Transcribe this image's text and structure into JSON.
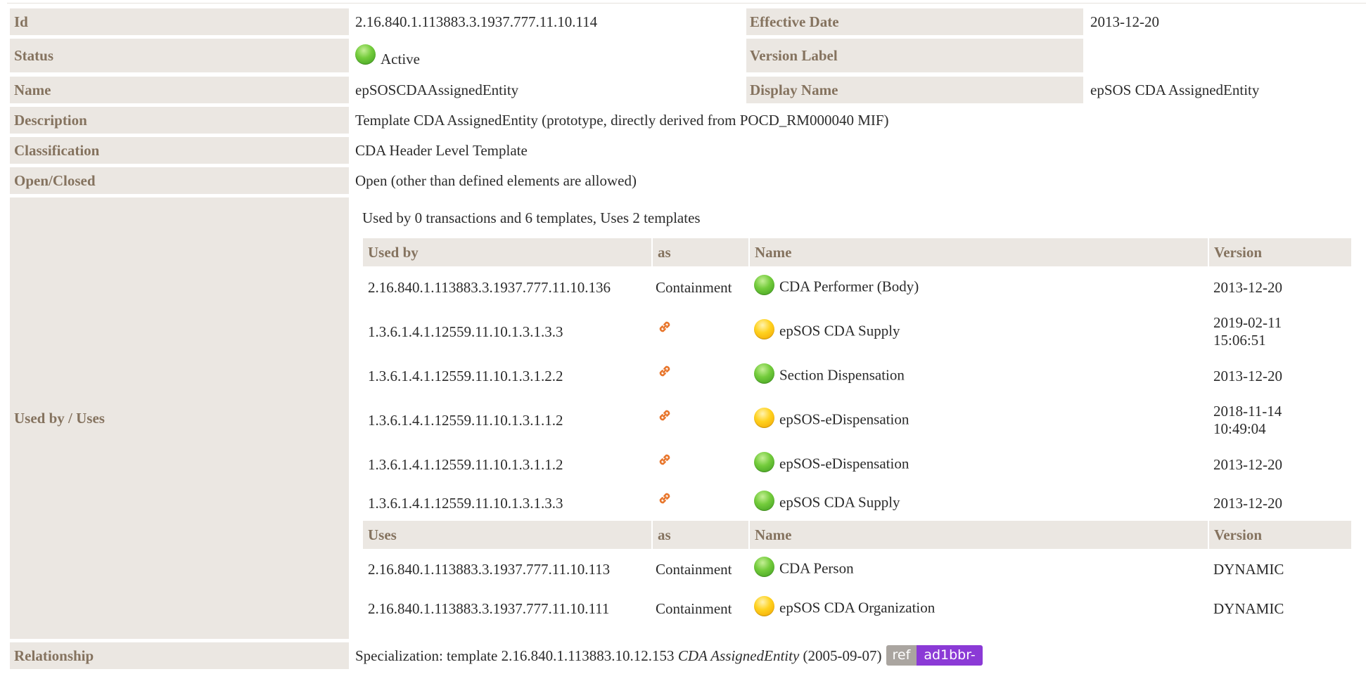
{
  "rows": {
    "id": {
      "label": "Id",
      "value": "2.16.840.1.113883.3.1937.777.11.10.114"
    },
    "effective_date": {
      "label": "Effective Date",
      "value": "2013-12-20"
    },
    "status": {
      "label": "Status",
      "value": "Active",
      "status_icon": "green-status-icon"
    },
    "version_label": {
      "label": "Version Label",
      "value": ""
    },
    "name": {
      "label": "Name",
      "value": "epSOSCDAAssignedEntity"
    },
    "display_name": {
      "label": "Display Name",
      "value": "epSOS CDA AssignedEntity"
    },
    "description": {
      "label": "Description",
      "value": "Template CDA AssignedEntity (prototype, directly derived from POCD_RM000040 MIF)"
    },
    "classification": {
      "label": "Classification",
      "value": "CDA Header Level Template"
    },
    "open_closed": {
      "label": "Open/Closed",
      "value": "Open (other than defined elements are allowed)"
    },
    "used_by_uses": {
      "label": "Used by / Uses"
    },
    "relationship": {
      "label": "Relationship",
      "prefix": "Specialization: template 2.16.840.1.113883.10.12.153",
      "template_name": "CDA AssignedEntity",
      "date": "(2005-09-07)",
      "badge_ref": "ref",
      "badge_id": "ad1bbr-"
    }
  },
  "uses_table": {
    "summary": "Used by 0 transactions and 6 templates, Uses 2 templates",
    "used_by_header": {
      "col1": "Used by",
      "col2": "as",
      "col3": "Name",
      "col4": "Version"
    },
    "used_by": [
      {
        "id": "2.16.840.1.113883.3.1937.777.11.10.136",
        "as": "Containment",
        "status": "green",
        "name": "CDA Performer (Body)",
        "version_line1": "2013-12-20",
        "version_line2": ""
      },
      {
        "id": "1.3.6.1.4.1.12559.11.10.1.3.1.3.3",
        "as": "",
        "as_icon": "link-icon",
        "status": "yellow",
        "name": "epSOS CDA Supply",
        "version_line1": "2019-02-11",
        "version_line2": "15:06:51"
      },
      {
        "id": "1.3.6.1.4.1.12559.11.10.1.3.1.2.2",
        "as": "",
        "as_icon": "link-icon",
        "status": "green",
        "name": "Section Dispensation",
        "version_line1": "2013-12-20",
        "version_line2": ""
      },
      {
        "id": "1.3.6.1.4.1.12559.11.10.1.3.1.1.2",
        "as": "",
        "as_icon": "link-icon",
        "status": "yellow",
        "name": "epSOS-eDispensation",
        "version_line1": "2018-11-14",
        "version_line2": "10:49:04"
      },
      {
        "id": "1.3.6.1.4.1.12559.11.10.1.3.1.1.2",
        "as": "",
        "as_icon": "link-icon",
        "status": "green",
        "name": "epSOS-eDispensation",
        "version_line1": "2013-12-20",
        "version_line2": ""
      },
      {
        "id": "1.3.6.1.4.1.12559.11.10.1.3.1.3.3",
        "as": "",
        "as_icon": "link-icon",
        "status": "green",
        "name": "epSOS CDA Supply",
        "version_line1": "2013-12-20",
        "version_line2": ""
      }
    ],
    "uses_header": {
      "col1": "Uses",
      "col2": "as",
      "col3": "Name",
      "col4": "Version"
    },
    "uses": [
      {
        "id": "2.16.840.1.113883.3.1937.777.11.10.113",
        "as": "Containment",
        "status": "green",
        "name": "CDA Person",
        "version": "DYNAMIC"
      },
      {
        "id": "2.16.840.1.113883.3.1937.777.11.10.111",
        "as": "Containment",
        "status": "yellow",
        "name": "epSOS CDA Organization",
        "version": "DYNAMIC"
      }
    ]
  },
  "colors": {
    "label_bg": "#ebe7e2",
    "label_text": "#85735f",
    "status_active": "#5cb82e",
    "status_draft": "#ffc81a",
    "link_icon": "#e8762c",
    "badge_ref": "#aaa5a0",
    "badge_id": "#8b3ad6"
  }
}
